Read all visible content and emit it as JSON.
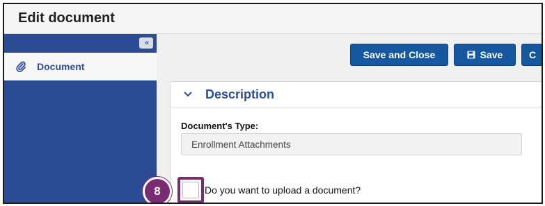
{
  "window": {
    "title": "Edit document"
  },
  "sidebar": {
    "collapse_icon": "double-chevron-left-icon",
    "items": [
      {
        "label": "Document",
        "icon": "paperclip-icon"
      }
    ],
    "color": "#2c4d96"
  },
  "toolbar": {
    "save_close_label": "Save and Close",
    "save_label": "Save",
    "save_icon": "floppy-disk-icon",
    "extra_label": "C",
    "button_color": "#1558a0"
  },
  "panel": {
    "title": "Description",
    "expanded_icon": "chevron-down-icon",
    "document_type_label": "Document's Type:",
    "document_type_value": "Enrollment Attachments",
    "upload_question": "Do you want to upload a document?",
    "upload_checked": false
  },
  "annotation": {
    "step_number": "8",
    "color": "#7a2c73"
  }
}
